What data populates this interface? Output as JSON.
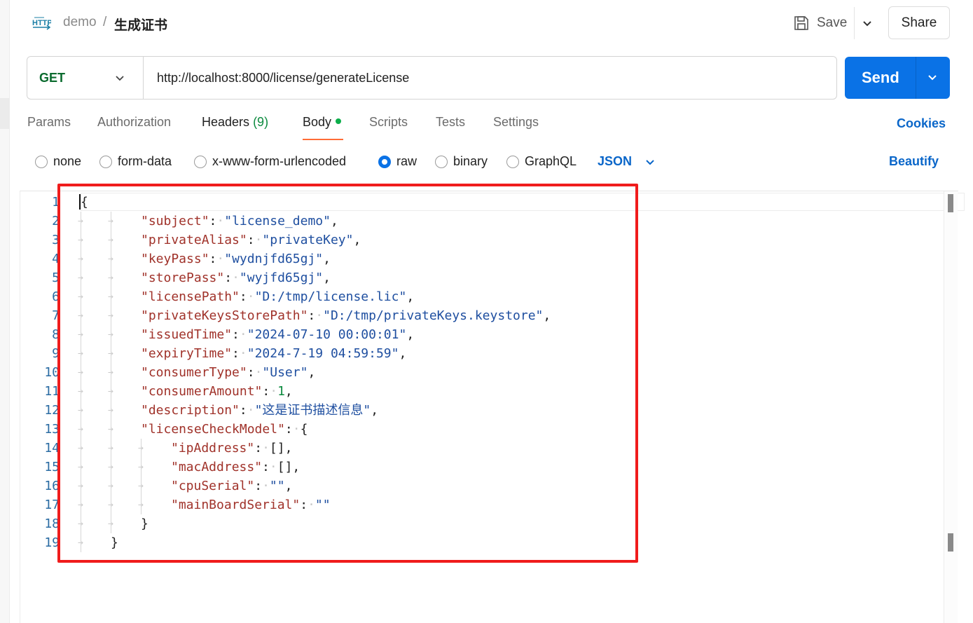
{
  "header": {
    "icon_name": "http-icon",
    "icon_text": "HTTP",
    "breadcrumb_parent": "demo",
    "breadcrumb_sep": "/",
    "title": "生成证书",
    "save_label": "Save",
    "share_label": "Share"
  },
  "request": {
    "method": "GET",
    "url": "http://localhost:8000/license/generateLicense",
    "send_label": "Send"
  },
  "tabs": [
    {
      "label": "Params"
    },
    {
      "label": "Authorization"
    },
    {
      "label": "Headers",
      "count": "(9)"
    },
    {
      "label": "Body",
      "active": true
    },
    {
      "label": "Scripts"
    },
    {
      "label": "Tests"
    },
    {
      "label": "Settings"
    }
  ],
  "cookies_label": "Cookies",
  "body_options": [
    {
      "label": "none",
      "checked": false
    },
    {
      "label": "form-data",
      "checked": false
    },
    {
      "label": "x-www-form-urlencoded",
      "checked": false
    },
    {
      "label": "raw",
      "checked": true
    },
    {
      "label": "binary",
      "checked": false
    },
    {
      "label": "GraphQL",
      "checked": false
    }
  ],
  "format_label": "JSON",
  "beautify_label": "Beautify",
  "editor": {
    "lines": [
      {
        "num": "1",
        "depth": 0,
        "key": "",
        "value": "",
        "open": "{"
      },
      {
        "num": "2",
        "depth": 2,
        "key": "\"subject\"",
        "value": "\"license_demo\"",
        "vtype": "s",
        "comma": ","
      },
      {
        "num": "3",
        "depth": 2,
        "key": "\"privateAlias\"",
        "value": "\"privateKey\"",
        "vtype": "s",
        "comma": ","
      },
      {
        "num": "4",
        "depth": 2,
        "key": "\"keyPass\"",
        "value": "\"wydnjfd65gj\"",
        "vtype": "s",
        "comma": ","
      },
      {
        "num": "5",
        "depth": 2,
        "key": "\"storePass\"",
        "value": "\"wyjfd65gj\"",
        "vtype": "s",
        "comma": ","
      },
      {
        "num": "6",
        "depth": 2,
        "key": "\"licensePath\"",
        "value": "\"D:/tmp/license.lic\"",
        "vtype": "s",
        "comma": ","
      },
      {
        "num": "7",
        "depth": 2,
        "key": "\"privateKeysStorePath\"",
        "value": "\"D:/tmp/privateKeys.keystore\"",
        "vtype": "s",
        "comma": ","
      },
      {
        "num": "8",
        "depth": 2,
        "key": "\"issuedTime\"",
        "value": "\"2024-07-10 00:00:01\"",
        "vtype": "s",
        "comma": ","
      },
      {
        "num": "9",
        "depth": 2,
        "key": "\"expiryTime\"",
        "value": "\"2024-7-19 04:59:59\"",
        "vtype": "s",
        "comma": ","
      },
      {
        "num": "10",
        "depth": 2,
        "key": "\"consumerType\"",
        "value": "\"User\"",
        "vtype": "s",
        "comma": ","
      },
      {
        "num": "11",
        "depth": 2,
        "key": "\"consumerAmount\"",
        "value": "1",
        "vtype": "n",
        "comma": ","
      },
      {
        "num": "12",
        "depth": 2,
        "key": "\"description\"",
        "value": "\"这是证书描述信息\"",
        "vtype": "s",
        "comma": ","
      },
      {
        "num": "13",
        "depth": 2,
        "key": "\"licenseCheckModel\"",
        "value": "{",
        "vtype": "p",
        "comma": ""
      },
      {
        "num": "14",
        "depth": 3,
        "key": "\"ipAddress\"",
        "value": "[]",
        "vtype": "p",
        "comma": ","
      },
      {
        "num": "15",
        "depth": 3,
        "key": "\"macAddress\"",
        "value": "[]",
        "vtype": "p",
        "comma": ","
      },
      {
        "num": "16",
        "depth": 3,
        "key": "\"cpuSerial\"",
        "value": "\"\"",
        "vtype": "s",
        "comma": ","
      },
      {
        "num": "17",
        "depth": 3,
        "key": "\"mainBoardSerial\"",
        "value": "\"\"",
        "vtype": "s",
        "comma": ""
      },
      {
        "num": "18",
        "depth": 2,
        "key": "",
        "value": "",
        "close": "}"
      },
      {
        "num": "19",
        "depth": 1,
        "key": "",
        "value": "",
        "close": "}"
      }
    ]
  },
  "colors": {
    "accent": "#0a72e6",
    "method_get": "#0b6b2e",
    "active_tab_underline": "#ff6c37",
    "body_dot": "#0cae4a",
    "json_key": "#a0322a",
    "json_string": "#1f4fa0",
    "json_number": "#0b8a3e",
    "highlight_box": "#f01c1c"
  }
}
